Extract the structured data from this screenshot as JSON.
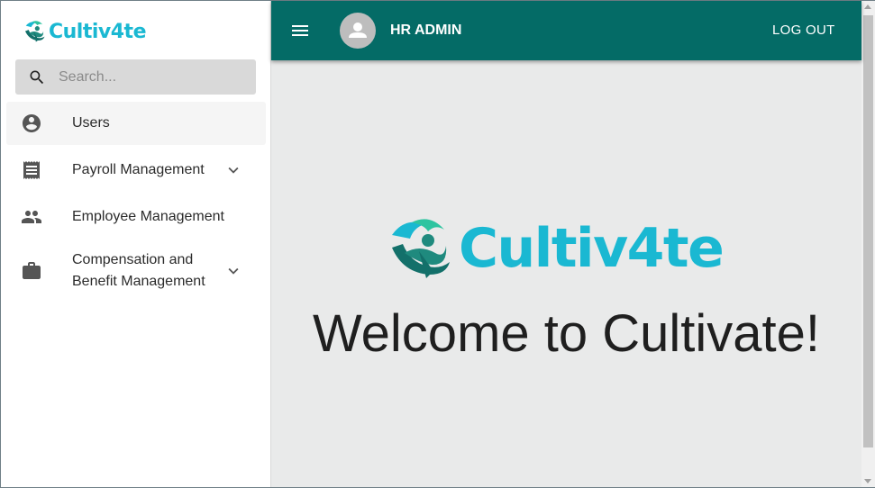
{
  "brand": {
    "name": "Cultiv4te"
  },
  "search": {
    "placeholder": "Search..."
  },
  "sidebar": {
    "items": [
      {
        "label": "Users",
        "icon": "account-circle-icon",
        "active": true
      },
      {
        "label": "Payroll Management",
        "icon": "receipt-icon",
        "expandable": true
      },
      {
        "label": "Employee Management",
        "icon": "people-icon"
      },
      {
        "label_line1": "Compensation and",
        "label_line2": "Benefit Management",
        "icon": "briefcase-icon",
        "expandable": true
      }
    ]
  },
  "header": {
    "user_name": "HR ADMIN",
    "logout_label": "LOG OUT"
  },
  "main": {
    "welcome": "Welcome to Cultivate!"
  },
  "colors": {
    "appbar": "#046b66",
    "brand_cyan": "#1ab8d2",
    "brand_teal": "#1f8a7e",
    "content_bg": "#e9eaea"
  }
}
